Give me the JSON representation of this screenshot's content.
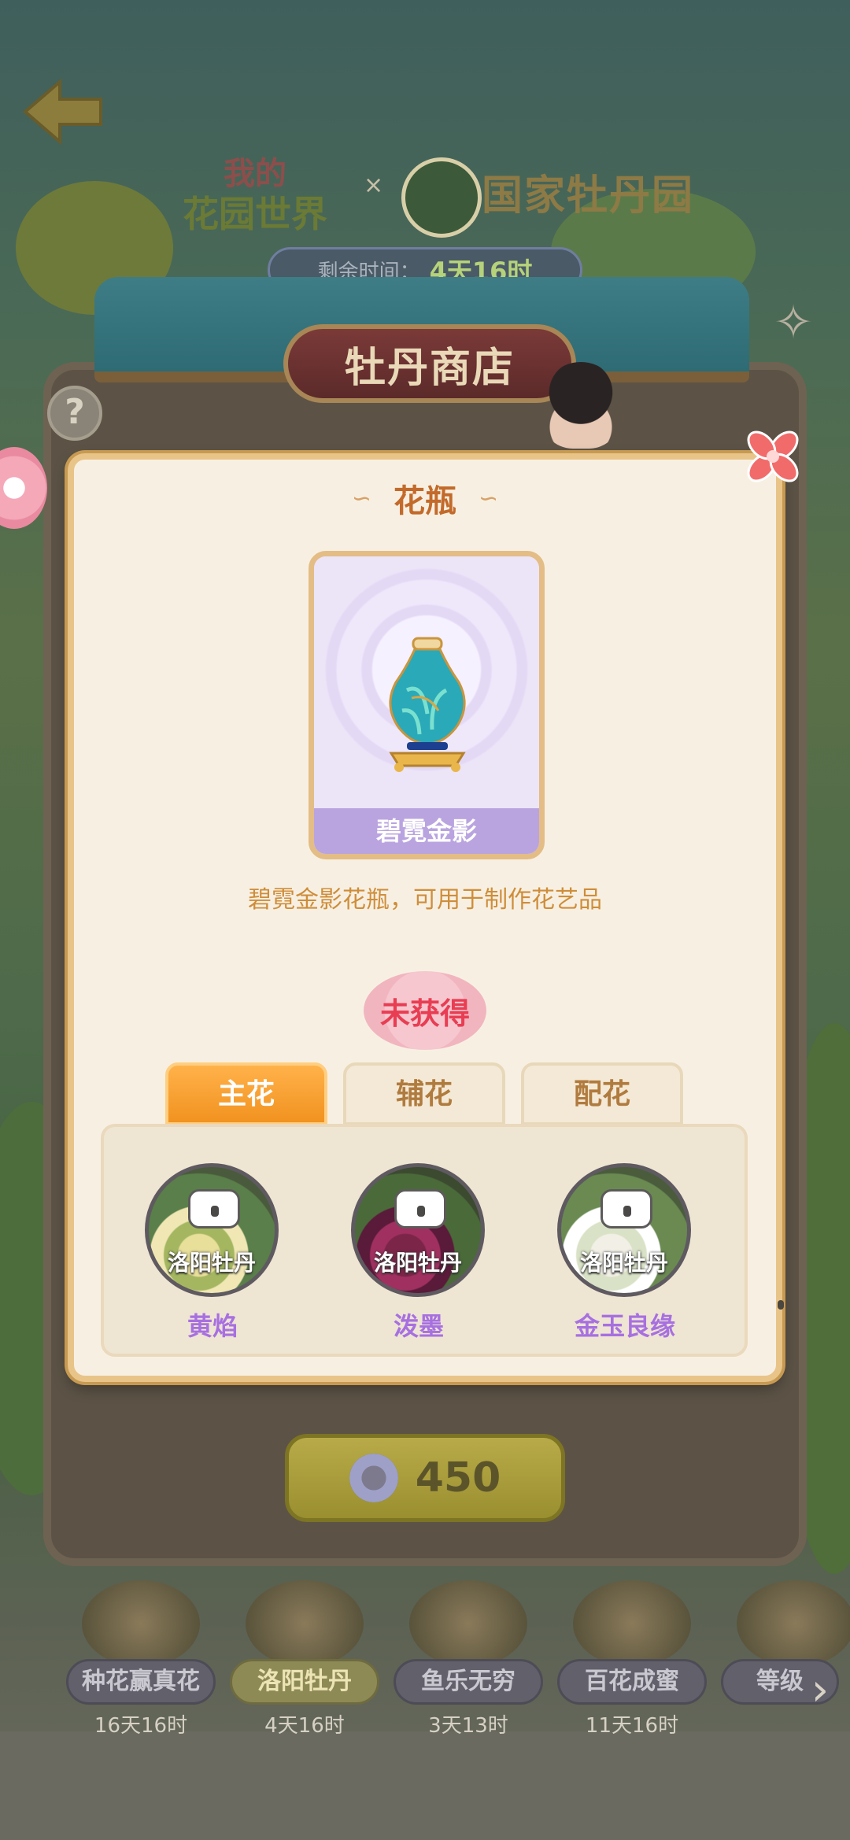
{
  "header": {
    "game_logo_line1": "我的",
    "game_logo_line2": "花园世界",
    "collab_symbol": "×",
    "park_name": "国家牡丹园",
    "timer_label": "剩余时间：",
    "timer_value": "4天16时"
  },
  "shop": {
    "title": "牡丹商店",
    "help_icon": "?",
    "price": "450"
  },
  "popup": {
    "title": "花瓶",
    "item_name": "碧霓金影",
    "description": "碧霓金影花瓶，可用于制作花艺品",
    "status": "未获得",
    "tabs": [
      {
        "label": "主花",
        "active": true
      },
      {
        "label": "辅花",
        "active": false
      },
      {
        "label": "配花",
        "active": false
      }
    ],
    "flowers": [
      {
        "caption": "洛阳牡丹",
        "name": "黄焰"
      },
      {
        "caption": "洛阳牡丹",
        "name": "泼墨"
      },
      {
        "caption": "洛阳牡丹",
        "name": "金玉良缘"
      }
    ]
  },
  "categories": [
    {
      "label": "种花赢真花",
      "time": "16天16时",
      "active": false
    },
    {
      "label": "洛阳牡丹",
      "time": "4天16时",
      "active": true
    },
    {
      "label": "鱼乐无穷",
      "time": "3天13时",
      "active": false
    },
    {
      "label": "百花成蜜",
      "time": "11天16时",
      "active": false
    },
    {
      "label": "等级",
      "time": "",
      "active": false
    }
  ],
  "colors": {
    "accent_orange": "#f19220",
    "status_red": "#e83d53",
    "flower_name_purple": "#a770e0",
    "popup_bg": "#f7f0e2"
  }
}
